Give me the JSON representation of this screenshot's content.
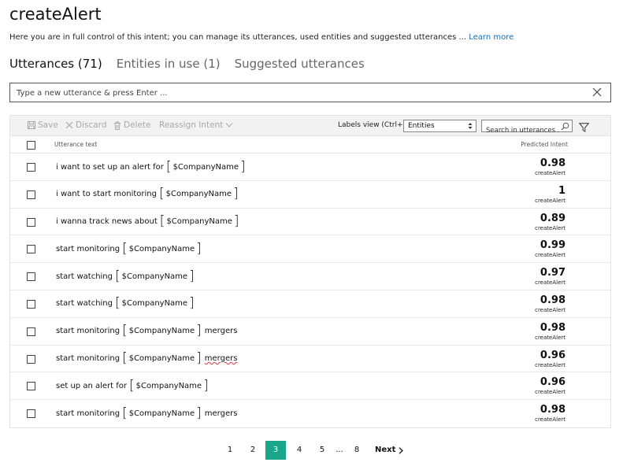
{
  "page": {
    "title": "createAlert",
    "description": "Here you are in full control of this intent; you can manage its utterances, used entities and suggested utterances ...",
    "learn_more": "Learn more"
  },
  "tabs": [
    {
      "label": "Utterances (71)",
      "active": true
    },
    {
      "label": "Entities in use (1)",
      "active": false
    },
    {
      "label": "Suggested utterances",
      "active": false
    }
  ],
  "new_utterance": {
    "placeholder": "Type a new utterance & press Enter ..."
  },
  "toolbar": {
    "save": "Save",
    "discard": "Discard",
    "delete": "Delete",
    "reassign": "Reassign Intent",
    "labels_view_label": "Labels view (Ctrl+E):",
    "labels_view_value": "Entities",
    "search_placeholder": "Search in utterances ..."
  },
  "table": {
    "col_utterance": "Utterance text",
    "col_predicted": "Predicted Intent",
    "rows": [
      {
        "before": "i want to set up an alert for",
        "entity": "$CompanyName",
        "after": "",
        "score": "0.98",
        "intent": "createAlert"
      },
      {
        "before": "i want to start monitoring",
        "entity": "$CompanyName",
        "after": "",
        "score": "1",
        "intent": "createAlert"
      },
      {
        "before": "i wanna track news about",
        "entity": "$CompanyName",
        "after": "",
        "score": "0.89",
        "intent": "createAlert"
      },
      {
        "before": "start monitoring",
        "entity": "$CompanyName",
        "after": "",
        "score": "0.99",
        "intent": "createAlert"
      },
      {
        "before": "start watching",
        "entity": "$CompanyName",
        "after": "",
        "score": "0.97",
        "intent": "createAlert"
      },
      {
        "before": "start watching",
        "entity": "$CompanyName",
        "after": "",
        "score": "0.98",
        "intent": "createAlert"
      },
      {
        "before": "start monitoring",
        "entity": "$CompanyName",
        "after": "mergers",
        "score": "0.98",
        "intent": "createAlert"
      },
      {
        "before": "start monitoring",
        "entity": "$CompanyName",
        "after": "mergers",
        "score": "0.96",
        "intent": "createAlert"
      },
      {
        "before": "set up an alert for",
        "entity": "$CompanyName",
        "after": "",
        "score": "0.96",
        "intent": "createAlert"
      },
      {
        "before": "start monitoring",
        "entity": "$CompanyName",
        "after": "mergers",
        "score": "0.98",
        "intent": "createAlert"
      }
    ]
  },
  "pagination": {
    "pages": [
      "1",
      "2",
      "3",
      "4",
      "5"
    ],
    "current": "3",
    "ellipsis": "...",
    "last": "8",
    "next": "Next"
  },
  "colors": {
    "accent": "#1aa68b",
    "link": "#0a6fc2",
    "disabled": "#a8a8a8"
  }
}
